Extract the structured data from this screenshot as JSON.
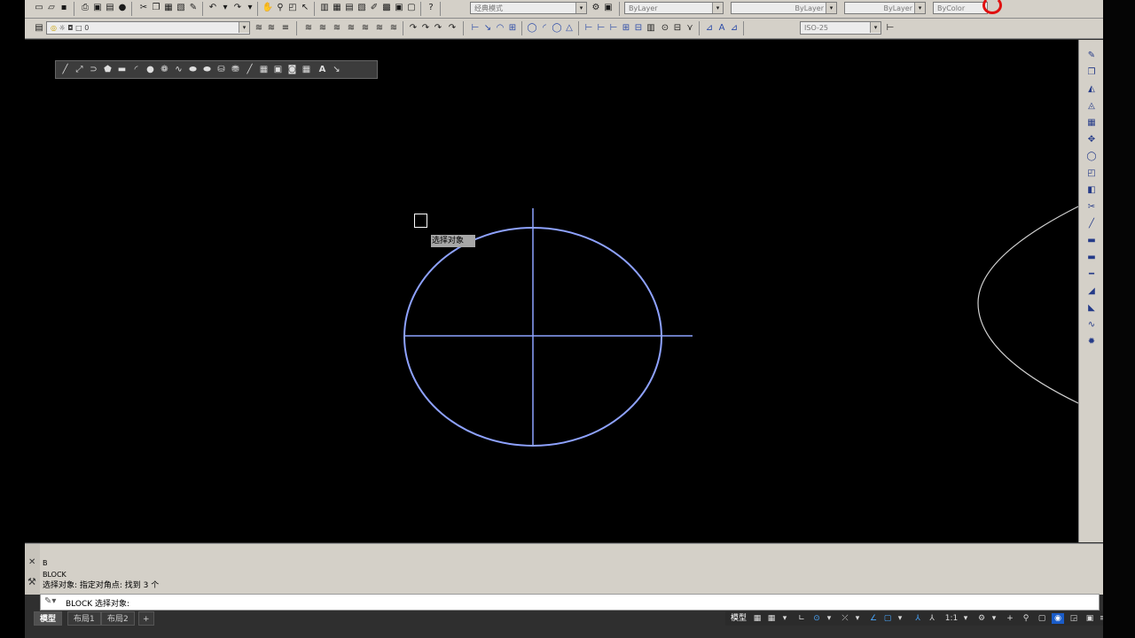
{
  "toolbar": {
    "workspace": "经典模式",
    "color": "ByLayer",
    "linetype": "ByLayer",
    "lineweight": "ByLayer",
    "plotstyle": "ByColor",
    "layer": "0",
    "dimstyle": "ISO-25"
  },
  "canvas": {
    "tooltip": "选择对象",
    "drawing_color": "#8ea2ff",
    "background": "#000000"
  },
  "command": {
    "history": [
      "B",
      "BLOCK",
      "选择对象: 指定对角点: 找到 3 个"
    ],
    "prompt": "BLOCK 选择对象:"
  },
  "layout_tabs": [
    "模型",
    "布局1",
    "布局2",
    "+"
  ],
  "status": {
    "model_label": "模型",
    "scale": "1:1"
  }
}
